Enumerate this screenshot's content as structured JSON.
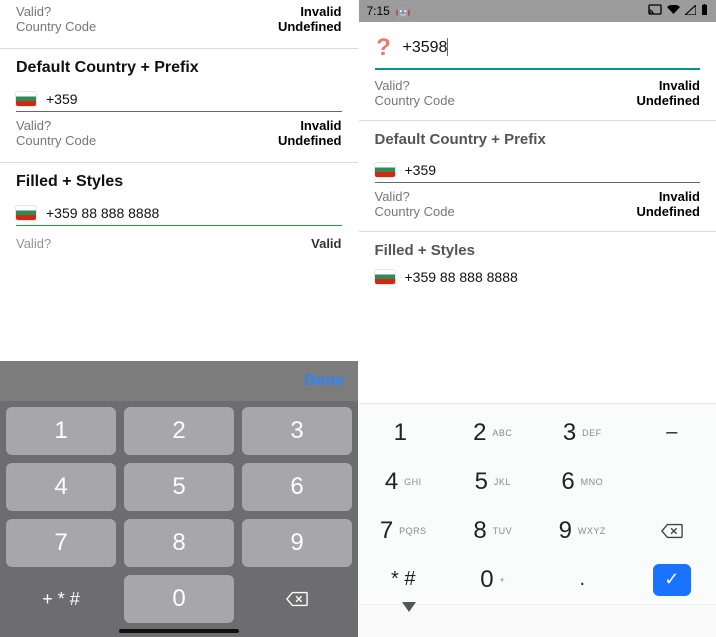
{
  "left": {
    "block1": {
      "valid_label": "Valid?",
      "valid_value": "Invalid",
      "code_label": "Country Code",
      "code_value": "Undefined"
    },
    "section2_title": "Default Country + Prefix",
    "block2_phone": "+359",
    "block2": {
      "valid_label": "Valid?",
      "valid_value": "Invalid",
      "code_label": "Country Code",
      "code_value": "Undefined"
    },
    "section3_title": "Filled + Styles",
    "block3_phone": "+359 88 888 8888",
    "cropped_valid_label": "Valid?",
    "cropped_valid_value": "Valid",
    "keyboard": {
      "done": "Done",
      "keys": {
        "k1": "1",
        "k2": "2",
        "k3": "3",
        "k4": "4",
        "k5": "5",
        "k6": "6",
        "k7": "7",
        "k8": "8",
        "k9": "9",
        "k0": "0",
        "sym": "+ * #"
      }
    }
  },
  "right": {
    "status_time": "7:15",
    "input_value": "+3598",
    "block1": {
      "valid_label": "Valid?",
      "valid_value": "Invalid",
      "code_label": "Country Code",
      "code_value": "Undefined"
    },
    "section2_title": "Default Country + Prefix",
    "block2_phone": "+359",
    "block2": {
      "valid_label": "Valid?",
      "valid_value": "Invalid",
      "code_label": "Country Code",
      "code_value": "Undefined"
    },
    "section3_title": "Filled + Styles",
    "block3_phone": "+359 88 888 8888",
    "keyboard": {
      "layout": [
        {
          "d": "1",
          "s": ""
        },
        {
          "d": "2",
          "s": "ABC"
        },
        {
          "d": "3",
          "s": "DEF"
        },
        {
          "d": "–",
          "s": ""
        },
        {
          "d": "4",
          "s": "GHI"
        },
        {
          "d": "5",
          "s": "JKL"
        },
        {
          "d": "6",
          "s": "MNO"
        },
        {
          "d": "7",
          "s": "PQRS"
        },
        {
          "d": "8",
          "s": "TUV"
        },
        {
          "d": "9",
          "s": "WXYZ"
        },
        {
          "d": "* #",
          "s": ""
        },
        {
          "d": "0",
          "s": "+"
        },
        {
          "d": ".",
          "s": ""
        }
      ]
    }
  }
}
